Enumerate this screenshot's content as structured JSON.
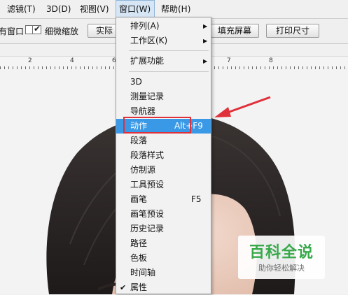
{
  "menubar": {
    "items": [
      "滤镜(T)",
      "3D(D)",
      "视图(V)",
      "窗口(W)",
      "帮助(H)"
    ]
  },
  "options": {
    "window_partial": "有窗口",
    "scrubby_zoom_label": "细微缩放",
    "scrubby_zoom_checked": true,
    "actual_pixels": "实际",
    "fill_screen": "填充屏幕",
    "print_size": "打印尺寸"
  },
  "ruler": {
    "labels": [
      "2",
      "4",
      "6",
      "7",
      "8"
    ]
  },
  "window_menu": {
    "arrange": "排列(A)",
    "workspace": "工作区(K)",
    "extensions": "扩展功能",
    "items": [
      {
        "label": "3D",
        "shortcut": ""
      },
      {
        "label": "测量记录",
        "shortcut": ""
      },
      {
        "label": "导航器",
        "shortcut": ""
      },
      {
        "label": "动作",
        "shortcut": "Alt+F9"
      },
      {
        "label": "段落",
        "shortcut": ""
      },
      {
        "label": "段落样式",
        "shortcut": ""
      },
      {
        "label": "仿制源",
        "shortcut": ""
      },
      {
        "label": "工具预设",
        "shortcut": ""
      },
      {
        "label": "画笔",
        "shortcut": "F5"
      },
      {
        "label": "画笔预设",
        "shortcut": ""
      },
      {
        "label": "历史记录",
        "shortcut": ""
      },
      {
        "label": "路径",
        "shortcut": ""
      },
      {
        "label": "色板",
        "shortcut": ""
      },
      {
        "label": "时间轴",
        "shortcut": ""
      },
      {
        "label": "属性",
        "shortcut": ""
      }
    ]
  },
  "watermark": {
    "title": "百科全说",
    "subtitle": "助你轻松解决"
  },
  "colors": {
    "highlight": "#3a99e6",
    "annotation_red": "#e0303a",
    "watermark_green": "#37a94a"
  }
}
